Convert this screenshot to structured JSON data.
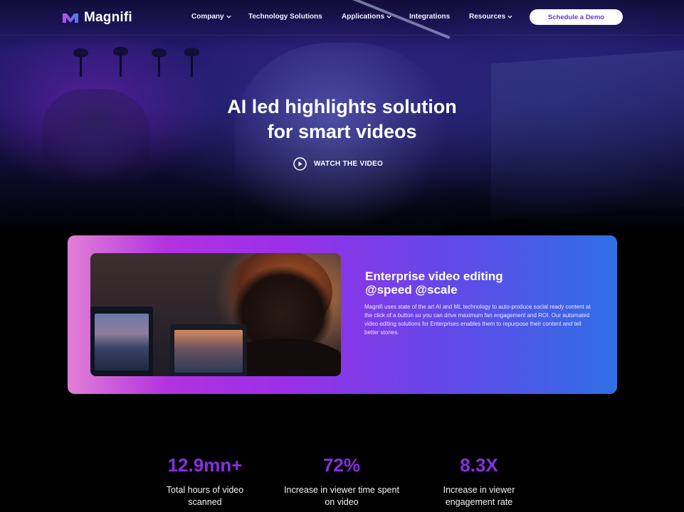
{
  "nav": {
    "brand": "Magnifi",
    "items": [
      {
        "label": "Company",
        "has_dropdown": true
      },
      {
        "label": "Technology Solutions",
        "has_dropdown": false
      },
      {
        "label": "Applications",
        "has_dropdown": true
      },
      {
        "label": "Integrations",
        "has_dropdown": false
      },
      {
        "label": "Resources",
        "has_dropdown": true
      }
    ],
    "cta_label": "Schedule a Demo"
  },
  "hero": {
    "title_line1": "AI led highlights solution",
    "title_line2": "for smart videos",
    "watch_label": "WATCH THE VIDEO",
    "watch_icon": "play-circle-icon"
  },
  "feature": {
    "title_line1": "Enterprise video editing",
    "title_line2": "@speed @scale",
    "body": "Magnifi uses state of the art AI and ML technology to auto-produce social ready content at the click of a button so you can drive maximum fan engagement and ROI. Our automated video editing solutions for Enterprises enables them to repurpose their content and tell better stories."
  },
  "stats": [
    {
      "value": "12.9mn+",
      "label": "Total hours of video scanned"
    },
    {
      "value": "72%",
      "label": "Increase in viewer time spent on video"
    },
    {
      "value": "8.3X",
      "label": "Increase in viewer engagement rate"
    }
  ],
  "colors": {
    "accent": "#8a2ee0",
    "cta_text": "#5a3be0",
    "card_gradient_start": "#e27fd6",
    "card_gradient_end": "#2f6fe6"
  }
}
